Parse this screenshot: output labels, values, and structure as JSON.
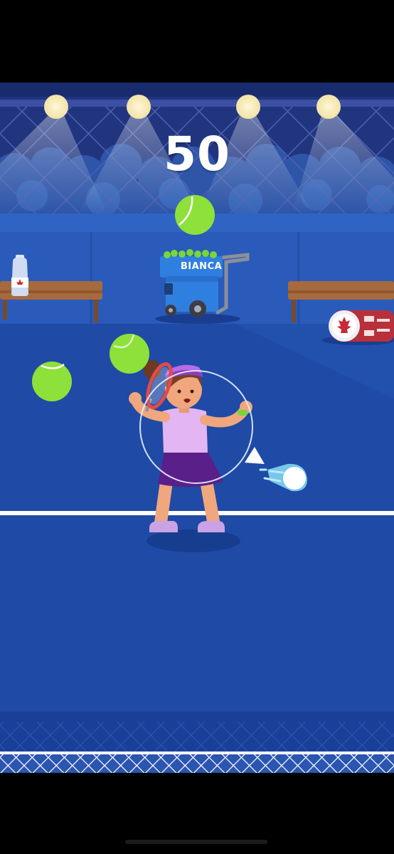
{
  "game": {
    "score": "50",
    "ball_machine_label": "BIANCA"
  },
  "colors": {
    "court": "#1e4aa8",
    "court_dark": "#173a8c",
    "crowd_bg": "#233a8e",
    "wall": "#2559b7",
    "ball": "#8ee03a",
    "net_white": "#ffffff",
    "court_line": "#ffffff"
  },
  "icons": {
    "ball_machine": "tennis-ball-machine-icon",
    "water_bottle": "water-bottle-icon",
    "towel": "canada-towel-icon",
    "incoming_shot": "incoming-ball-indicator-icon"
  }
}
